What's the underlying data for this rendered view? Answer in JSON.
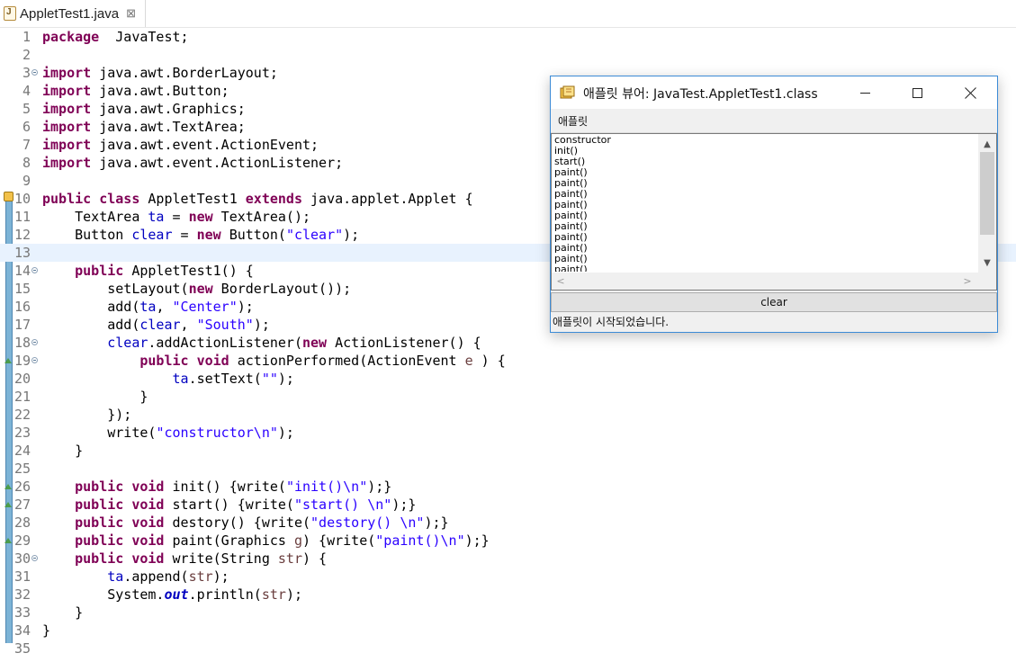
{
  "editor": {
    "tab": {
      "title": "AppletTest1.java",
      "close": "⊠"
    },
    "lines": [
      {
        "n": "1",
        "parts": [
          [
            "kw",
            "package"
          ],
          [
            "",
            "  JavaTest;"
          ]
        ]
      },
      {
        "n": "2",
        "parts": []
      },
      {
        "n": "3",
        "fold": true,
        "parts": [
          [
            "kw",
            "import"
          ],
          [
            "",
            " java.awt.BorderLayout;"
          ]
        ]
      },
      {
        "n": "4",
        "parts": [
          [
            "kw",
            "import"
          ],
          [
            "",
            " java.awt.Button;"
          ]
        ]
      },
      {
        "n": "5",
        "parts": [
          [
            "kw",
            "import"
          ],
          [
            "",
            " java.awt.Graphics;"
          ]
        ]
      },
      {
        "n": "6",
        "parts": [
          [
            "kw",
            "import"
          ],
          [
            "",
            " java.awt.TextArea;"
          ]
        ]
      },
      {
        "n": "7",
        "parts": [
          [
            "kw",
            "import"
          ],
          [
            "",
            " java.awt.event.ActionEvent;"
          ]
        ]
      },
      {
        "n": "8",
        "parts": [
          [
            "kw",
            "import"
          ],
          [
            "",
            " java.awt.event.ActionListener;"
          ]
        ]
      },
      {
        "n": "9",
        "parts": []
      },
      {
        "n": "10",
        "parts": [
          [
            "kw",
            "public"
          ],
          [
            "",
            " "
          ],
          [
            "kw",
            "class"
          ],
          [
            "",
            " AppletTest1 "
          ],
          [
            "kw",
            "extends"
          ],
          [
            "",
            " java.applet.Applet {"
          ]
        ]
      },
      {
        "n": "11",
        "parts": [
          [
            "",
            "    TextArea "
          ],
          [
            "fld",
            "ta"
          ],
          [
            "",
            " = "
          ],
          [
            "kw",
            "new"
          ],
          [
            "",
            " TextArea();"
          ]
        ]
      },
      {
        "n": "12",
        "parts": [
          [
            "",
            "    Button "
          ],
          [
            "fld",
            "clear"
          ],
          [
            "",
            " = "
          ],
          [
            "kw",
            "new"
          ],
          [
            "",
            " Button("
          ],
          [
            "str",
            "\"clear\""
          ],
          [
            "",
            ");"
          ]
        ]
      },
      {
        "n": "13",
        "current": true,
        "parts": []
      },
      {
        "n": "14",
        "fold": true,
        "parts": [
          [
            "",
            "    "
          ],
          [
            "kw",
            "public"
          ],
          [
            "",
            " AppletTest1() {"
          ]
        ]
      },
      {
        "n": "15",
        "parts": [
          [
            "",
            "        setLayout("
          ],
          [
            "kw",
            "new"
          ],
          [
            "",
            " BorderLayout());"
          ]
        ]
      },
      {
        "n": "16",
        "parts": [
          [
            "",
            "        add("
          ],
          [
            "fld",
            "ta"
          ],
          [
            "",
            ", "
          ],
          [
            "str",
            "\"Center\""
          ],
          [
            "",
            ");"
          ]
        ]
      },
      {
        "n": "17",
        "parts": [
          [
            "",
            "        add("
          ],
          [
            "fld",
            "clear"
          ],
          [
            "",
            ", "
          ],
          [
            "str",
            "\"South\""
          ],
          [
            "",
            ");"
          ]
        ]
      },
      {
        "n": "18",
        "fold": true,
        "parts": [
          [
            "",
            "        "
          ],
          [
            "fld",
            "clear"
          ],
          [
            "",
            ".addActionListener("
          ],
          [
            "kw",
            "new"
          ],
          [
            "",
            " ActionListener() {"
          ]
        ]
      },
      {
        "n": "19",
        "fold": true,
        "parts": [
          [
            "",
            "            "
          ],
          [
            "kw",
            "public"
          ],
          [
            "",
            " "
          ],
          [
            "kw",
            "void"
          ],
          [
            "",
            " actionPerformed(ActionEvent "
          ],
          [
            "var",
            "e"
          ],
          [
            "",
            " ) {"
          ]
        ]
      },
      {
        "n": "20",
        "parts": [
          [
            "",
            "                "
          ],
          [
            "fld",
            "ta"
          ],
          [
            "",
            ".setText("
          ],
          [
            "str",
            "\"\""
          ],
          [
            "",
            ");"
          ]
        ]
      },
      {
        "n": "21",
        "parts": [
          [
            "",
            "            }"
          ]
        ]
      },
      {
        "n": "22",
        "parts": [
          [
            "",
            "        });"
          ]
        ]
      },
      {
        "n": "23",
        "parts": [
          [
            "",
            "        write("
          ],
          [
            "str",
            "\"constructor\\n\""
          ],
          [
            "",
            ");"
          ]
        ]
      },
      {
        "n": "24",
        "parts": [
          [
            "",
            "    }"
          ]
        ]
      },
      {
        "n": "25",
        "parts": []
      },
      {
        "n": "26",
        "parts": [
          [
            "",
            "    "
          ],
          [
            "kw",
            "public"
          ],
          [
            "",
            " "
          ],
          [
            "kw",
            "void"
          ],
          [
            "",
            " init() {write("
          ],
          [
            "str",
            "\"init()\\n\""
          ],
          [
            "",
            ");}"
          ]
        ]
      },
      {
        "n": "27",
        "parts": [
          [
            "",
            "    "
          ],
          [
            "kw",
            "public"
          ],
          [
            "",
            " "
          ],
          [
            "kw",
            "void"
          ],
          [
            "",
            " start() {write("
          ],
          [
            "str",
            "\"start() \\n\""
          ],
          [
            "",
            ");}"
          ]
        ]
      },
      {
        "n": "28",
        "parts": [
          [
            "",
            "    "
          ],
          [
            "kw",
            "public"
          ],
          [
            "",
            " "
          ],
          [
            "kw",
            "void"
          ],
          [
            "",
            " destory() {write("
          ],
          [
            "str",
            "\"destory() \\n\""
          ],
          [
            "",
            ");}"
          ]
        ]
      },
      {
        "n": "29",
        "parts": [
          [
            "",
            "    "
          ],
          [
            "kw",
            "public"
          ],
          [
            "",
            " "
          ],
          [
            "kw",
            "void"
          ],
          [
            "",
            " paint(Graphics "
          ],
          [
            "var",
            "g"
          ],
          [
            "",
            ") {write("
          ],
          [
            "str",
            "\"paint()\\n\""
          ],
          [
            "",
            ");}"
          ]
        ]
      },
      {
        "n": "30",
        "fold": true,
        "parts": [
          [
            "",
            "    "
          ],
          [
            "kw",
            "public"
          ],
          [
            "",
            " "
          ],
          [
            "kw",
            "void"
          ],
          [
            "",
            " write(String "
          ],
          [
            "var",
            "str"
          ],
          [
            "",
            ") {"
          ]
        ]
      },
      {
        "n": "31",
        "parts": [
          [
            "",
            "        "
          ],
          [
            "fld",
            "ta"
          ],
          [
            "",
            ".append("
          ],
          [
            "var",
            "str"
          ],
          [
            "",
            ");"
          ]
        ]
      },
      {
        "n": "32",
        "parts": [
          [
            "",
            "        System."
          ],
          [
            "stf",
            "out"
          ],
          [
            "",
            ".println("
          ],
          [
            "var",
            "str"
          ],
          [
            "",
            ");"
          ]
        ]
      },
      {
        "n": "33",
        "parts": [
          [
            "",
            "    }"
          ]
        ]
      },
      {
        "n": "34",
        "parts": [
          [
            "",
            "}"
          ]
        ]
      },
      {
        "n": "35",
        "parts": []
      }
    ]
  },
  "applet_viewer": {
    "title": "애플릿 뷰어: JavaTest.AppletTest1.class",
    "menu": "애플릿",
    "textarea_lines": [
      "constructor",
      "init()",
      "start()",
      "paint()",
      "paint()",
      "paint()",
      "paint()",
      "paint()",
      "paint()",
      "paint()",
      "paint()",
      "paint()",
      "paint()"
    ],
    "button_label": "clear",
    "status": "애플릿이 시작되었습니다."
  }
}
